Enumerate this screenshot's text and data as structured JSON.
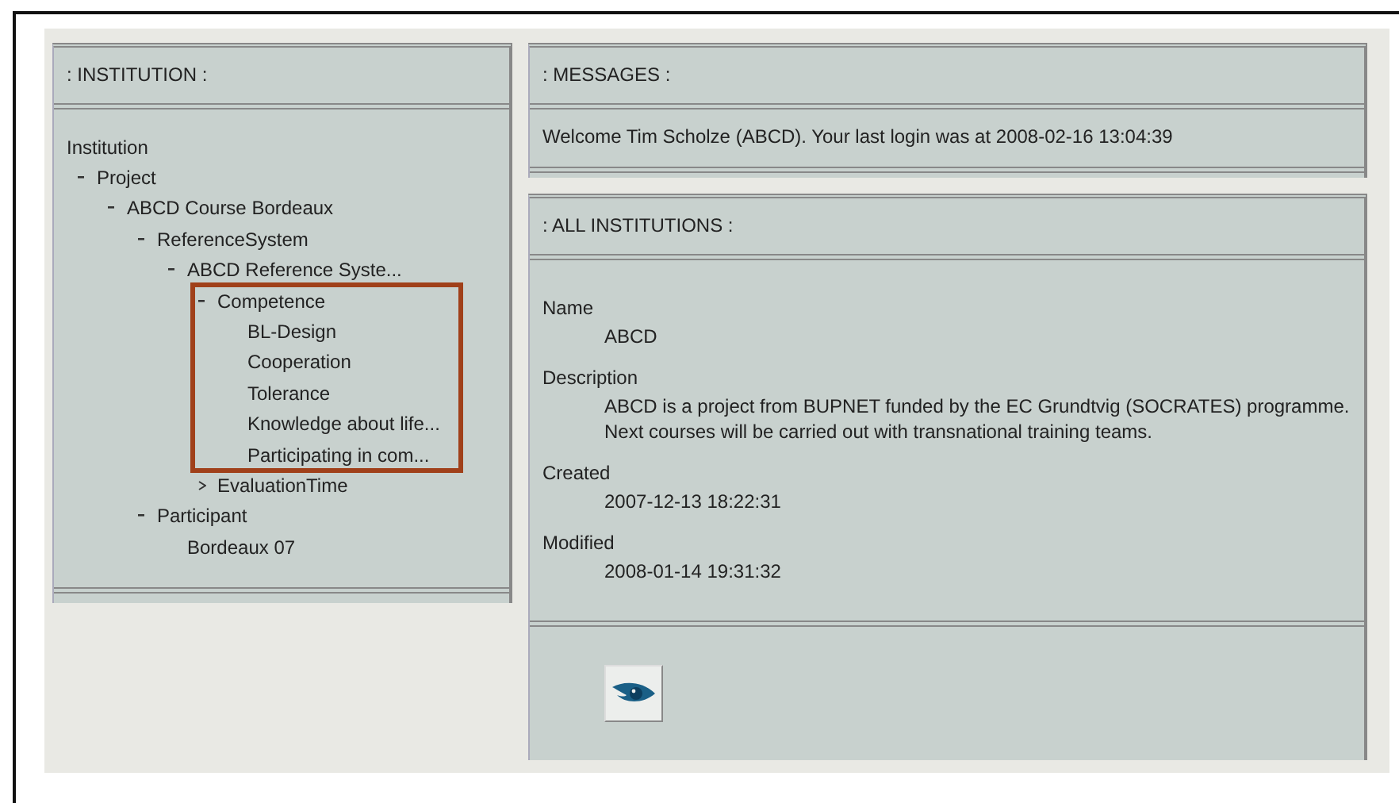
{
  "institution_panel": {
    "title": ": INSTITUTION :",
    "tree": {
      "label": "Institution",
      "children": [
        {
          "label": "Project",
          "expanded": true,
          "children": [
            {
              "label": "ABCD Course Bordeaux",
              "expanded": true,
              "children": [
                {
                  "label": "ReferenceSystem",
                  "expanded": true,
                  "children": [
                    {
                      "label": "ABCD Reference Syste...",
                      "expanded": true,
                      "children": [
                        {
                          "label": "Competence",
                          "expanded": true,
                          "highlighted": true,
                          "children": [
                            {
                              "label": "BL-Design"
                            },
                            {
                              "label": "Cooperation"
                            },
                            {
                              "label": "Tolerance"
                            },
                            {
                              "label": "Knowledge about life..."
                            },
                            {
                              "label": "Participating in com..."
                            }
                          ]
                        },
                        {
                          "label": "EvaluationTime",
                          "expanded": false
                        }
                      ]
                    }
                  ]
                },
                {
                  "label": "Participant",
                  "expanded": true,
                  "children": [
                    {
                      "label": "Bordeaux 07"
                    }
                  ]
                }
              ]
            }
          ]
        }
      ]
    }
  },
  "messages_panel": {
    "title": ": MESSAGES :",
    "message": "Welcome Tim Scholze (ABCD). Your last login was at 2008-02-16 13:04:39"
  },
  "all_institutions_panel": {
    "title": ": ALL INSTITUTIONS :",
    "fields": [
      {
        "label": "Name",
        "value": "ABCD"
      },
      {
        "label": "Description",
        "value": "ABCD is a project from BUPNET funded by the EC Grundtvig (SOCRATES) programme. Next courses will be carried out with transnational training teams."
      },
      {
        "label": "Created",
        "value": "2007-12-13 18:22:31"
      },
      {
        "label": "Modified",
        "value": "2008-01-14 19:31:32"
      }
    ]
  }
}
